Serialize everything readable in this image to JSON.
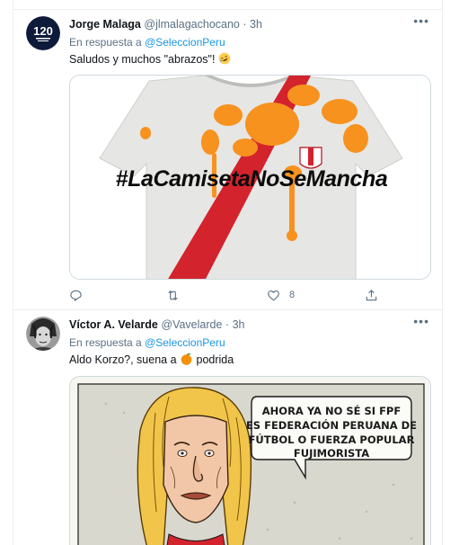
{
  "tweets": [
    {
      "author": "Jorge Malaga",
      "handle": "@jlmalagachocano",
      "separator": "·",
      "time": "3h",
      "reply_prefix": "En respuesta a",
      "reply_to": "@SeleccionPeru",
      "text": "Saludos y muchos \"abrazos\"!",
      "emoji": "rolling-on-floor-laughing",
      "image": {
        "kind": "peru-jersey-stained",
        "hashtag": "#LaCamisetaNoSeMancha",
        "colors": {
          "shirt": "#e9e9e9",
          "sash": "#d3232d",
          "stain": "#f7921e"
        }
      },
      "actions": {
        "reply_count": "",
        "retweet_count": "",
        "like_count": "8"
      }
    },
    {
      "author": "Víctor A. Velarde",
      "handle": "@Vavelarde",
      "separator": "·",
      "time": "3h",
      "reply_prefix": "En respuesta a",
      "reply_to": "@SeleccionPeru",
      "text_before": "Aldo Korzo?, suena a",
      "text_after": "podrida",
      "emoji": "tangerine",
      "image": {
        "kind": "caricature",
        "bubble_lines": [
          "AHORA YA NO SÉ SI FPF",
          "ES FEDERACIÓN PERUANA DE",
          "FÚTBOL O FUERZA POPULAR",
          "FUJIMORISTA"
        ]
      }
    }
  ],
  "colors": {
    "accent": "#1b95e0",
    "muted": "#5b7083",
    "border": "#ebeef0"
  }
}
